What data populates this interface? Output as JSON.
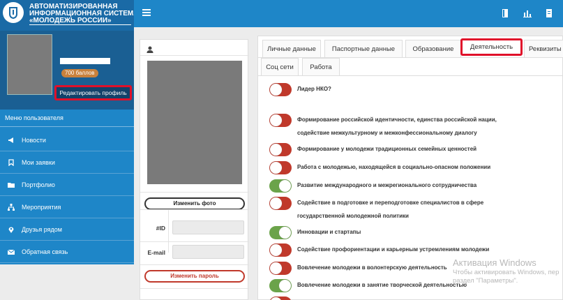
{
  "brand": {
    "line1": "АВТОМАТИЗИРОВАННАЯ",
    "line2": "ИНФОРМАЦИОННАЯ СИСТЕМА",
    "line3": "«МОЛОДЕЖЬ РОССИИ»"
  },
  "topbar": {
    "icons": [
      "menu-icon",
      "book-icon",
      "bar-chart-icon",
      "document-icon"
    ]
  },
  "profile": {
    "points": "700 баллов",
    "edit_label": "Редактировать профиль"
  },
  "menu": {
    "title": "Меню пользователя",
    "items": [
      {
        "label": "Новости",
        "icon": "megaphone-icon"
      },
      {
        "label": "Мои заявки",
        "icon": "bookmark-icon"
      },
      {
        "label": "Портфолио",
        "icon": "folder-icon"
      },
      {
        "label": "Мероприятия",
        "icon": "sitemap-icon"
      },
      {
        "label": "Друзья рядом",
        "icon": "map-marker-icon"
      },
      {
        "label": "Обратная связь",
        "icon": "envelope-icon"
      }
    ]
  },
  "photo_panel": {
    "change_photo": "Изменить фото",
    "id_label": "#ID",
    "id_value": "",
    "email_label": "E-mail",
    "email_value": "",
    "change_password": "Изменить пароль"
  },
  "tabs": {
    "row1": [
      "Личные данные",
      "Паспортные данные",
      "Образование",
      "Деятельность",
      "Реквизиты"
    ],
    "row2": [
      "Соц сети",
      "Работа"
    ],
    "active": "Деятельность"
  },
  "activity": [
    {
      "label": "Лидер НКО?",
      "on": false
    },
    {
      "label": "Формирование российской идентичности, единства российской нации,",
      "label2": "содействие межкультурному и межконфессиональному диалогу",
      "on": false
    },
    {
      "label": "Формирование у молодежи традиционных семейных ценностей",
      "on": false
    },
    {
      "label": "Работа с молодежью, находящейся в социально-опасном положении",
      "on": false
    },
    {
      "label": "Развитие международного и межрегионального сотрудничества",
      "on": true
    },
    {
      "label": "Содействие в подготовке и переподготовке специалистов в сфере",
      "label2": "государственной молодежной политики",
      "on": false
    },
    {
      "label": "Инновации и стартапы",
      "on": true
    },
    {
      "label": "Содействие профориентации и карьерным устремлениям молодежи",
      "on": false
    },
    {
      "label": "Вовлечение молодежи в волонтерскую деятельность",
      "on": false
    },
    {
      "label": "Вовлечение молодежи в занятие творческой деятельностью",
      "on": true
    }
  ],
  "watermark": {
    "title": "Активация Windows",
    "line1": "Чтобы активировать Windows, пер",
    "line2": "раздел \"Параметры\"."
  },
  "colors": {
    "header": "#1e86c8",
    "brand": "#1a6aa6",
    "toggle_off": "#c0392b",
    "toggle_on": "#6ba34a",
    "highlight": "#e0102a"
  }
}
